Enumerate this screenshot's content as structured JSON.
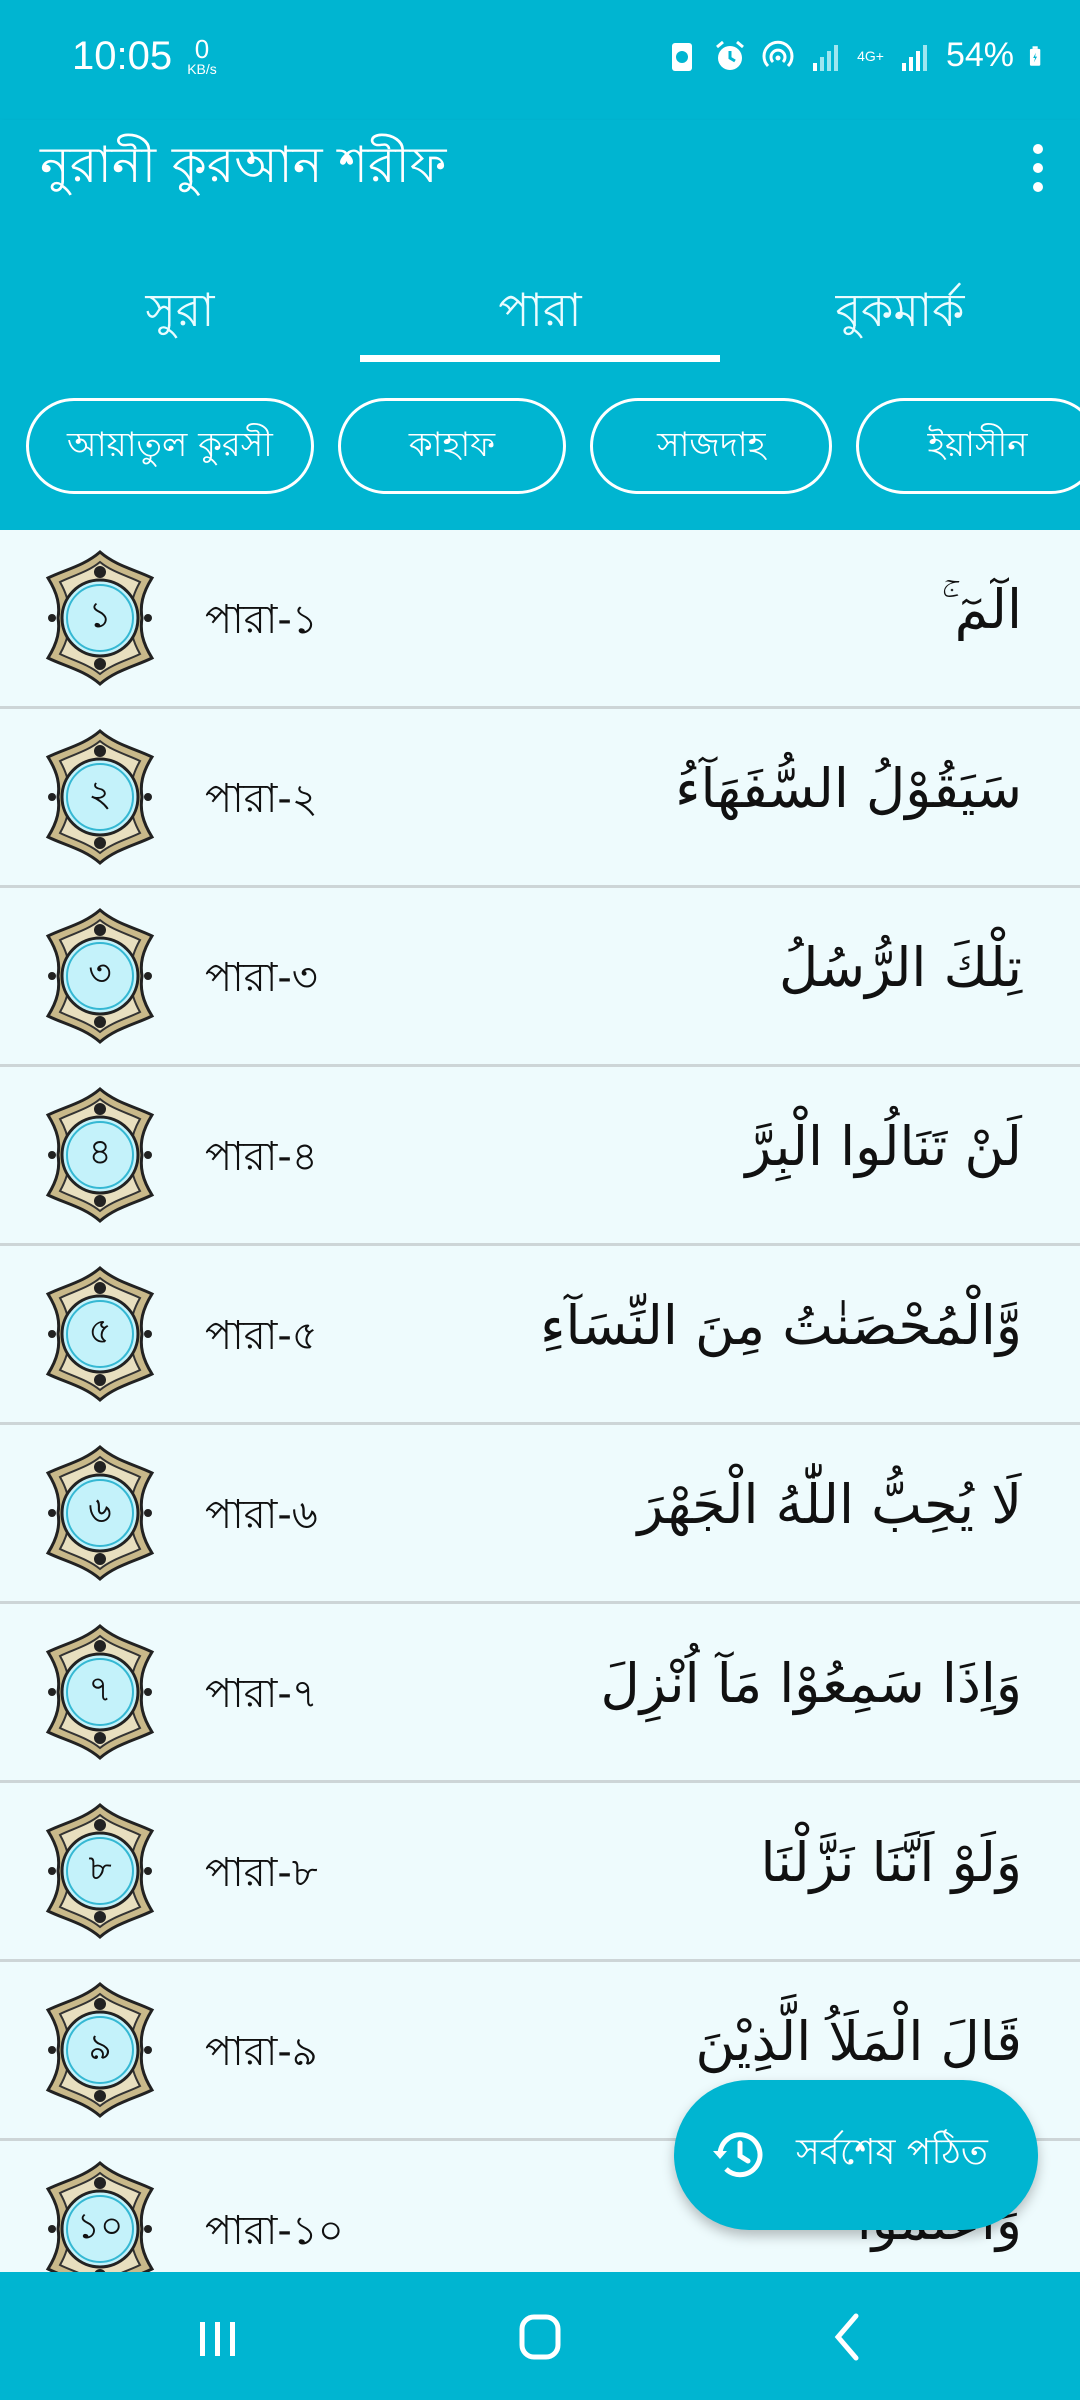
{
  "status": {
    "time": "10:05",
    "speed_value": "0",
    "speed_unit": "KB/s",
    "network": "4G+",
    "battery": "54%"
  },
  "app": {
    "title": "নুরানী কুরআন শরীফ",
    "menu_icon": "more-vert-icon"
  },
  "tabs": [
    {
      "label": "সুরা",
      "active": false
    },
    {
      "label": "পারা",
      "active": true
    },
    {
      "label": "বুকমার্ক",
      "active": false
    }
  ],
  "chips": [
    {
      "label": "আয়াতুল কুরসী"
    },
    {
      "label": "কাহাফ"
    },
    {
      "label": "সাজদাহ"
    },
    {
      "label": "ইয়াসীন"
    }
  ],
  "paras": [
    {
      "num": "১",
      "label": "পারা-১",
      "arabic": "الٓمٓ ۚ"
    },
    {
      "num": "২",
      "label": "পারা-২",
      "arabic": "سَيَقُوْلُ السُّفَهَآءُ"
    },
    {
      "num": "৩",
      "label": "পারা-৩",
      "arabic": "تِلْكَ الرُّسُلُ"
    },
    {
      "num": "৪",
      "label": "পারা-৪",
      "arabic": "لَنْ تَنَالُوا الْبِرَّ"
    },
    {
      "num": "৫",
      "label": "পারা-৫",
      "arabic": "وَّالْمُحْصَنٰتُ مِنَ النِّسَآءِ"
    },
    {
      "num": "৬",
      "label": "পারা-৬",
      "arabic": "لَا يُحِبُّ اللّٰهُ الْجَهْرَ"
    },
    {
      "num": "৭",
      "label": "পারা-৭",
      "arabic": "وَاِذَا سَمِعُوْا مَآ اُنْزِلَ"
    },
    {
      "num": "৮",
      "label": "পারা-৮",
      "arabic": "وَلَوْ اَنَّنَا نَزَّلْنَا"
    },
    {
      "num": "৯",
      "label": "পারা-৯",
      "arabic": "قَالَ الْمَلَاُ الَّذِيْنَ"
    },
    {
      "num": "১০",
      "label": "পারা-১০",
      "arabic": "وَاعْلَمُوْا"
    }
  ],
  "fab": {
    "label": "সর্বশেষ পঠিত",
    "icon": "history-icon"
  },
  "navbar": {
    "recents_icon": "recents-icon",
    "home_icon": "home-icon",
    "back_icon": "back-icon"
  },
  "colors": {
    "primary": "#00b5d1",
    "list_bg": "#eefbfd",
    "badge_gold": "#c9b98a",
    "badge_inner": "#c4f2fa"
  }
}
